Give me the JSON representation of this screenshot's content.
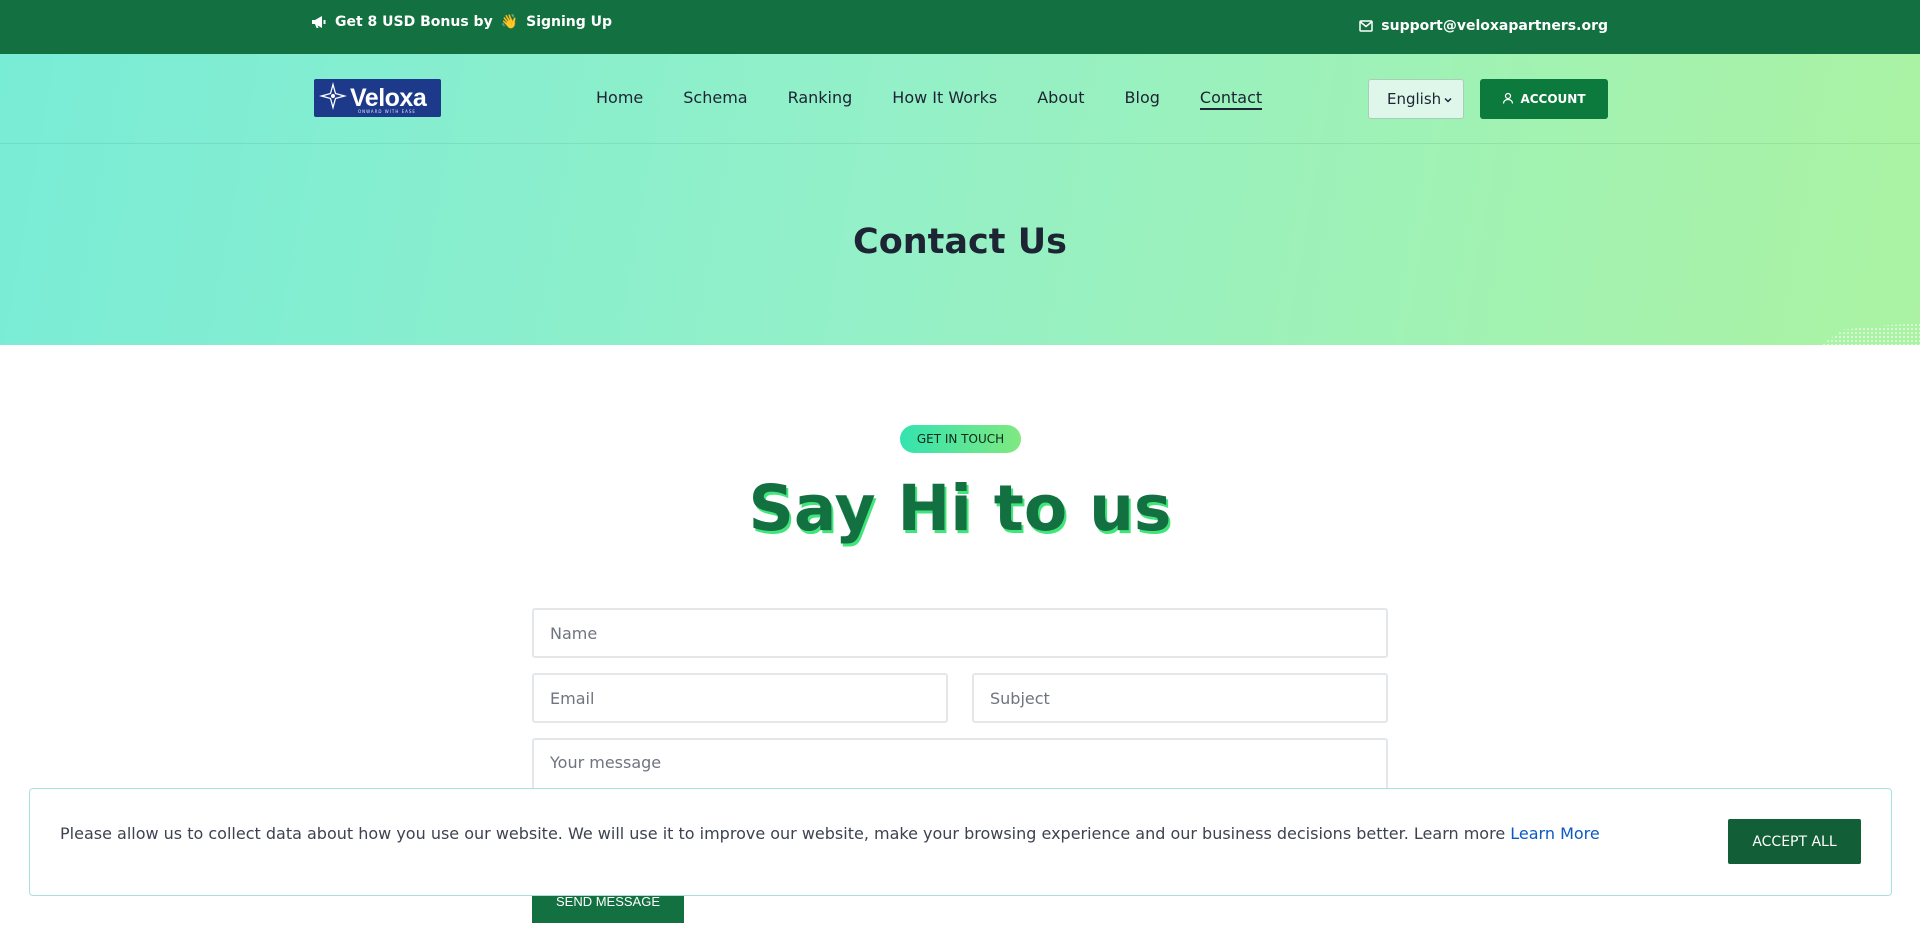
{
  "topbar": {
    "promo_part1": "Get 8 USD Bonus by",
    "promo_emoji": "👋",
    "promo_part2": "Signing Up",
    "email": "support@veloxapartners.org"
  },
  "brand": {
    "name": "Veloxa",
    "tagline": "ONWARD WITH EASE"
  },
  "nav": {
    "items": [
      {
        "label": "Home"
      },
      {
        "label": "Schema"
      },
      {
        "label": "Ranking"
      },
      {
        "label": "How It Works"
      },
      {
        "label": "About"
      },
      {
        "label": "Blog"
      },
      {
        "label": "Contact"
      }
    ],
    "active": "Contact"
  },
  "language": {
    "selected": "English"
  },
  "account_label": "ACCOUNT",
  "hero": {
    "title": "Contact Us"
  },
  "section": {
    "badge": "GET IN TOUCH",
    "heading": "Say Hi to us"
  },
  "form": {
    "name_placeholder": "Name",
    "email_placeholder": "Email",
    "subject_placeholder": "Subject",
    "message_placeholder": "Your message",
    "send_label": "SEND MESSAGE"
  },
  "cookie": {
    "text": "Please allow us to collect data about how you use our website. We will use it to improve our website, make your browsing experience and our business decisions better. Learn more",
    "link_label": "Learn More",
    "accept_label": "ACCEPT ALL"
  },
  "colors": {
    "topbar": "#137040",
    "accent_green": "#0c7a3d",
    "link_blue": "#0a59c2",
    "hero_gradient_start": "#79ecd6",
    "hero_gradient_end": "#abf3a3"
  }
}
